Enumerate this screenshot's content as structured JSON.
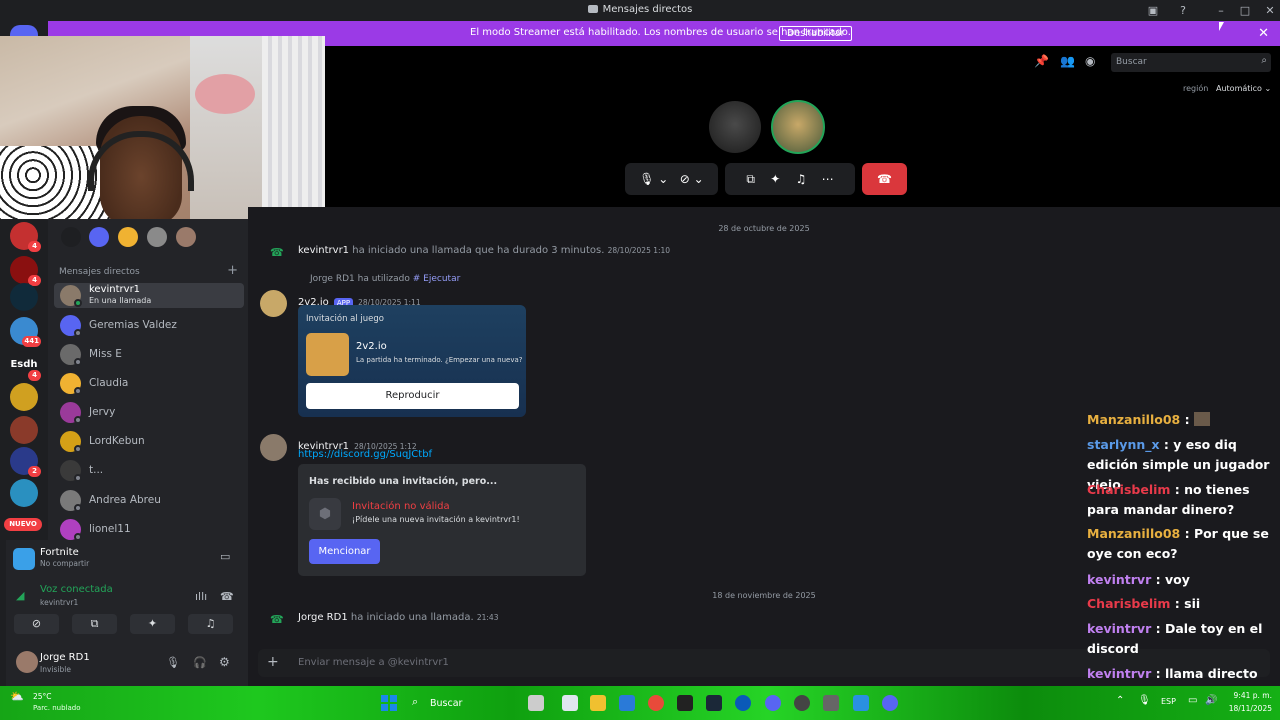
{
  "window": {
    "title": "Mensajes directos"
  },
  "banner": {
    "text": "El modo Streamer está habilitado. Los nombres de usuario se han truncado.",
    "button": "Deshabilitar"
  },
  "header": {
    "search_placeholder": "Buscar",
    "region_label": "región",
    "region_value": "Automático"
  },
  "servers": {
    "badges": [
      "4",
      "4",
      "441",
      "4",
      "4",
      "2"
    ],
    "esdh": "Esdh",
    "new_label": "NUEVO"
  },
  "sidebar": {
    "dm_header": "Mensajes directos",
    "dms": [
      {
        "name": "kevintrvr1",
        "status": "En una llamada",
        "color": "#8a7a6a"
      },
      {
        "name": "Geremias Valdez",
        "color": "#5865f2"
      },
      {
        "name": "Miss E",
        "color": "#6a6a6a"
      },
      {
        "name": "Claudia",
        "color": "#f0b232"
      },
      {
        "name": "Jervy",
        "color": "#9a3a9a"
      },
      {
        "name": "LordKebun",
        "color": "#d4a017"
      },
      {
        "name": "t...",
        "color": "#3a3a3a"
      },
      {
        "name": "Andrea Abreu",
        "color": "#7a7a7a"
      },
      {
        "name": "lionel11",
        "color": "#b040c0"
      }
    ]
  },
  "activity": {
    "game": "Fortnite",
    "sub": "No compartir"
  },
  "voice": {
    "status": "Voz conectada",
    "channel": "kevintrvr1"
  },
  "user": {
    "name": "Jorge RD1",
    "status": "Invisible"
  },
  "chat": {
    "date1": "28 de octubre de 2025",
    "call1_user": "kevintrvr1",
    "call1_text": "ha iniciado una llamada que ha durado 3 minutos.",
    "call1_time": "28/10/2025 1:10",
    "used_user": "Jorge RD1",
    "used_text": "ha utilizado",
    "used_cmd": "Ejecutar",
    "app_name": "2v2.io",
    "app_tag": "APP",
    "app_time": "28/10/2025 1:11",
    "invite_title": "Invitación al juego",
    "game_name": "2v2.io",
    "game_sub": "La partida ha terminado. ¿Empezar una nueva?",
    "play_button": "Reproducir",
    "msg2_user": "kevintrvr1",
    "msg2_time": "28/10/2025 1:12",
    "msg2_link": "https://discord.gg/SuqJCtbf",
    "inv_head": "Has recibido una invitación, pero...",
    "inv_invalid": "Invitación no válida",
    "inv_sub": "¡Pídele una nueva invitación a kevintrvr1!",
    "mention_button": "Mencionar",
    "date2": "18 de noviembre de 2025",
    "call2_user": "Jorge RD1",
    "call2_text": "ha iniciado una llamada.",
    "call2_time": "21:43",
    "input_placeholder": "Enviar mensaje a @kevintrvr1"
  },
  "twitch_chat": [
    {
      "user": "Manzanillo08",
      "msg": "",
      "color": "#e8b040"
    },
    {
      "user": "starlynn_x",
      "msg": "y eso diq edición simple un jugador viejo",
      "color": "#5a9ae8"
    },
    {
      "user": "Charisbelim",
      "msg": "no tienes para mandar dinero?",
      "color": "#e83a4a"
    },
    {
      "user": "Manzanillo08",
      "msg": "Por que se oye con eco?",
      "color": "#e8b040"
    },
    {
      "user": "kevintrvr",
      "msg": "voy",
      "color": "#c080f0"
    },
    {
      "user": "Charisbelim",
      "msg": "sii",
      "color": "#e83a4a"
    },
    {
      "user": "kevintrvr",
      "msg": "Dale toy en el discord",
      "color": "#c080f0"
    },
    {
      "user": "kevintrvr",
      "msg": "llama directo",
      "color": "#c080f0"
    }
  ],
  "taskbar": {
    "weather": "25°C",
    "weather_sub": "Parc. nublado",
    "search": "Buscar",
    "lang": "ESP",
    "time": "9:41 p. m.",
    "date": "18/11/2025"
  }
}
